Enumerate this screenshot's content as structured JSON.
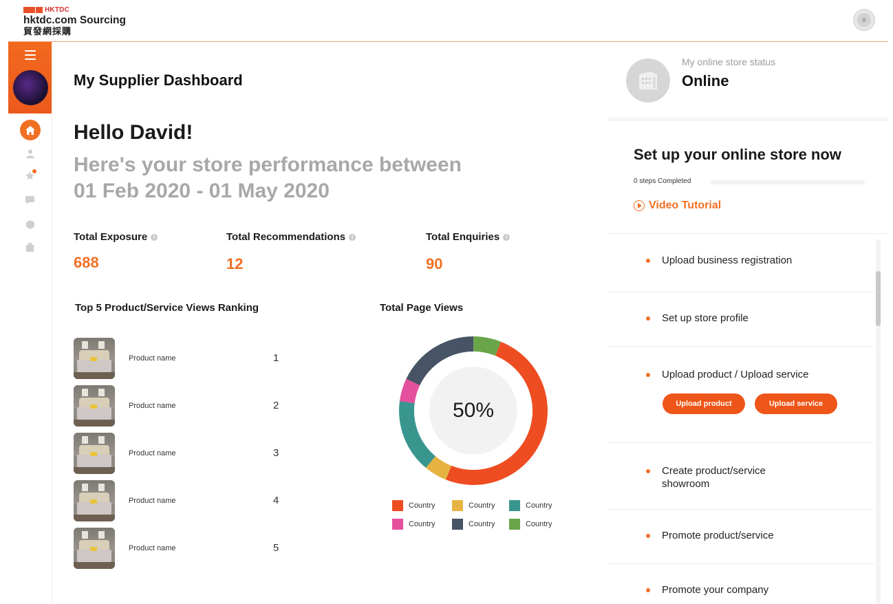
{
  "brand": {
    "mark": "HKTDC",
    "name": "hktdc.com Sourcing",
    "name_cn": "貿發網採購"
  },
  "main": {
    "page_title": "My Supplier Dashboard",
    "greeting": "Hello David!",
    "performance_line1": "Here's your store performance between",
    "performance_line2": "01 Feb 2020 - 01 May 2020",
    "stats": [
      {
        "label": "Total Exposure",
        "value": "688"
      },
      {
        "label": "Total Recommendations",
        "value": "12"
      },
      {
        "label": "Total Enquiries",
        "value": "90"
      }
    ],
    "ranking_title": "Top 5 Product/Service Views Ranking",
    "ranking": [
      {
        "name": "Product name",
        "rank": "1"
      },
      {
        "name": "Product name",
        "rank": "2"
      },
      {
        "name": "Product name",
        "rank": "3"
      },
      {
        "name": "Product name",
        "rank": "4"
      },
      {
        "name": "Product name",
        "rank": "5"
      }
    ],
    "page_views_title": "Total Page Views"
  },
  "chart_data": {
    "type": "pie",
    "title": "Total Page Views",
    "center_label": "50%",
    "slices": [
      {
        "label": "Country",
        "value": 50,
        "color": "#ee4d22"
      },
      {
        "label": "Country",
        "value": 5,
        "color": "#e6b343"
      },
      {
        "label": "Country",
        "value": 16,
        "color": "#39968f"
      },
      {
        "label": "Country",
        "value": 5,
        "color": "#e4509d"
      },
      {
        "label": "Country",
        "value": 18,
        "color": "#475466"
      },
      {
        "label": "Country",
        "value": 6,
        "color": "#6aa54a"
      }
    ],
    "legend": [
      "Country",
      "Country",
      "Country",
      "Country",
      "Country",
      "Country"
    ]
  },
  "right": {
    "status_label": "My online store status",
    "status_value": "Online",
    "setup_title": "Set up your online store now",
    "steps_completed": "0 steps Completed",
    "progress": 0,
    "video_label": "Video Tutorial",
    "steps": [
      {
        "label": "Upload business registration"
      },
      {
        "label": "Set up store profile"
      },
      {
        "label": "Upload product / Upload service"
      },
      {
        "label": "Create product/service showroom"
      },
      {
        "label": "Promote product/service"
      },
      {
        "label": "Promote your company"
      }
    ],
    "upload_product_button": "Upload product",
    "upload_service_button": "Upload service"
  },
  "colors": {
    "accent": "#f07023",
    "button": "#ee5518"
  }
}
